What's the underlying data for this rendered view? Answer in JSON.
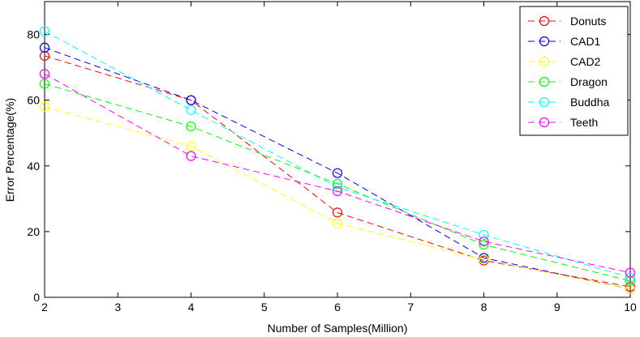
{
  "chart_data": {
    "type": "line",
    "title": "",
    "xlabel": "Number of Samples(Million)",
    "ylabel": "Error Percentage(%)",
    "x": [
      2,
      4,
      6,
      8,
      10
    ],
    "xlim": [
      2,
      10
    ],
    "ylim": [
      0,
      90
    ],
    "xticks": [
      "2",
      "3",
      "4",
      "5",
      "6",
      "7",
      "8",
      "9",
      "10"
    ],
    "yticks": [
      "0",
      "20",
      "40",
      "60",
      "80"
    ],
    "grid": false,
    "legend_position": "top-right",
    "line_style": "dashed",
    "marker": "circle",
    "series": [
      {
        "name": "Donuts",
        "color": "#ff0000",
        "values": [
          73.5,
          60,
          25.8,
          11.2,
          3.2
        ]
      },
      {
        "name": "CAD1",
        "color": "#0000ff",
        "values": [
          76,
          60,
          37.8,
          12,
          2.5
        ]
      },
      {
        "name": "CAD2",
        "color": "#ffff00",
        "values": [
          58,
          46,
          22.5,
          11.5,
          2.5
        ]
      },
      {
        "name": "Dragon",
        "color": "#00ff00",
        "values": [
          65,
          52,
          34.5,
          16,
          5
        ]
      },
      {
        "name": "Buddha",
        "color": "#00ffff",
        "values": [
          81,
          57,
          33.5,
          19,
          6
        ]
      },
      {
        "name": "Teeth",
        "color": "#ff00ff",
        "values": [
          68,
          43,
          32.3,
          17,
          7.5
        ]
      }
    ]
  }
}
